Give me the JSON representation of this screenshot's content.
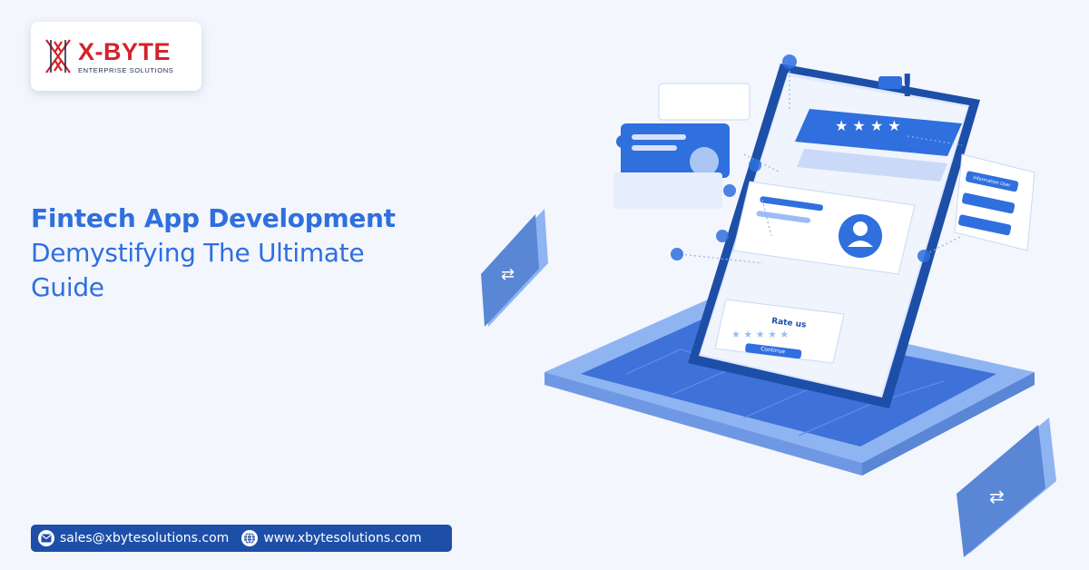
{
  "brand": {
    "name": "X-BYTE",
    "tagline": "ENTERPRISE SOLUTIONS",
    "color": "#d3232a"
  },
  "headline": {
    "line1": "Fintech App Development",
    "line2": "Demystifying The Ultimate",
    "line3": "Guide",
    "color": "#2f6fde"
  },
  "contact": {
    "email": "sales@xbytesolutions.com",
    "email_icon": "mail-icon",
    "website": "www.xbytesolutions.com",
    "website_icon": "globe-icon"
  },
  "illustration": {
    "rate_title": "Rate us",
    "rate_button": "Continue",
    "info_label": "Information User",
    "accent": "#2f6fde",
    "dark_accent": "#1d4fa8"
  }
}
